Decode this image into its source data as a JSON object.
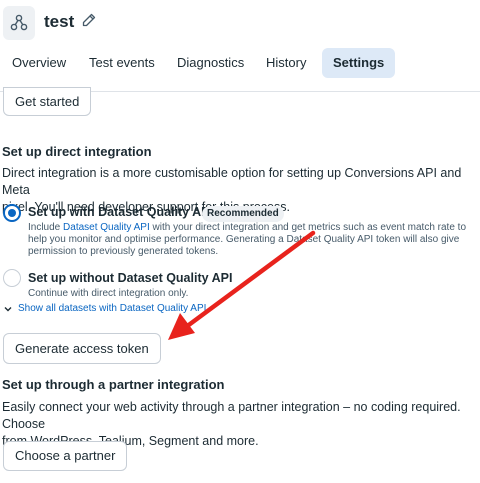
{
  "header": {
    "title": "test",
    "tabs": [
      {
        "label": "Overview",
        "active": false
      },
      {
        "label": "Test events",
        "active": false
      },
      {
        "label": "Diagnostics",
        "active": false
      },
      {
        "label": "History",
        "active": false
      },
      {
        "label": "Settings",
        "active": true
      }
    ]
  },
  "top": {
    "get_started_label": "Get started"
  },
  "direct_integration": {
    "heading": "Set up direct integration",
    "description_line1": "Direct integration is a more customisable option for setting up Conversions API and Meta",
    "description_line2": "pixel. You'll need developer support for this process.",
    "option1": {
      "title": "Set up with Dataset Quality API",
      "badge": "Recommended",
      "desc_prefix": "Include ",
      "desc_link": "Dataset Quality API",
      "desc_suffix": " with your direct integration and get metrics such as event match rate to",
      "desc_line2": "help you monitor and optimise performance. Generating a Dataset Quality API token will also give",
      "desc_line3": "permission to previously generated tokens.",
      "selected": true
    },
    "option2": {
      "title": "Set up without Dataset Quality API",
      "desc": "Continue with direct integration only.",
      "selected": false
    },
    "show_all_label": "Show all datasets with Dataset Quality API",
    "generate_label": "Generate access token"
  },
  "partner_integration": {
    "heading": "Set up through a partner integration",
    "description_line1": "Easily connect your web activity through a partner integration – no coding required. Choose",
    "description_line2": "from WordPress, Tealium, Segment and more.",
    "button_label": "Choose a partner"
  },
  "colors": {
    "accent": "#0a66c2",
    "annotation_arrow": "#e8231d",
    "active_tab_bg": "#dde9f7"
  },
  "icons": {
    "app": "dataset-nodes-icon",
    "edit": "pencil-icon",
    "expand": "chevron-down-icon"
  }
}
